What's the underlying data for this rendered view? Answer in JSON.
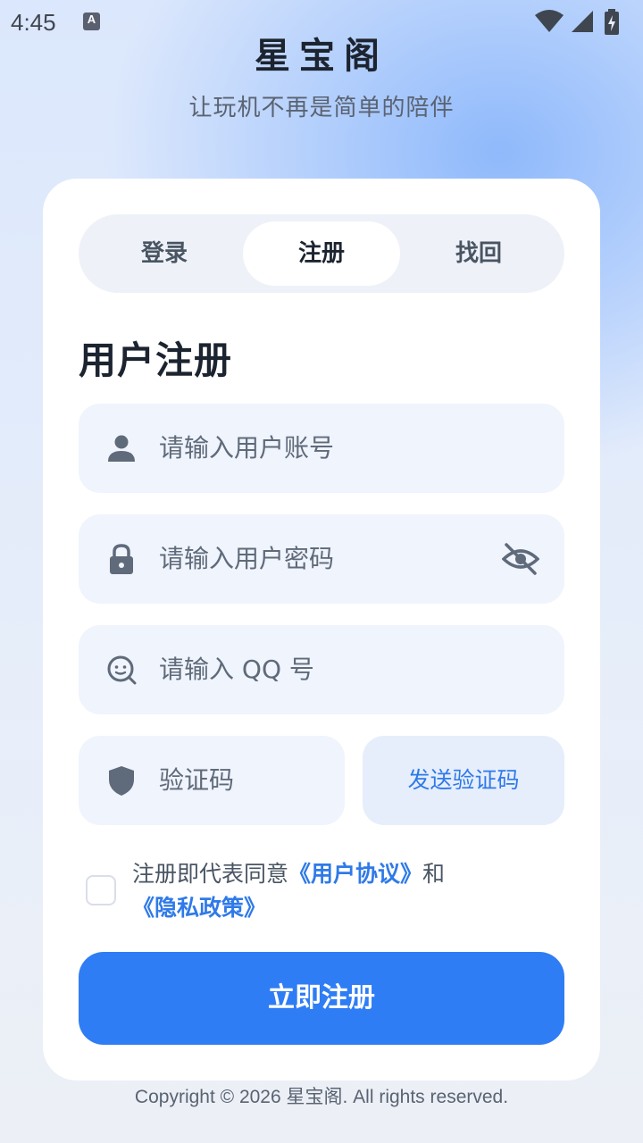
{
  "status_bar": {
    "time": "4:45",
    "notification_glyph": "A",
    "icons": [
      "notification-icon",
      "wifi-icon",
      "signal-icon",
      "battery-charging-icon"
    ]
  },
  "header": {
    "brand": "星宝阁",
    "slogan": "让玩机不再是简单的陪伴"
  },
  "tabs": [
    {
      "label": "登录",
      "active": false
    },
    {
      "label": "注册",
      "active": true
    },
    {
      "label": "找回",
      "active": false
    }
  ],
  "form": {
    "title": "用户注册",
    "account_placeholder": "请输入用户账号",
    "password_placeholder": "请输入用户密码",
    "qq_placeholder": "请输入 QQ 号",
    "code_placeholder": "验证码",
    "send_code_label": "发送验证码",
    "agreement": {
      "checked": false,
      "prefix": "注册即代表同意",
      "user_agreement": "《用户协议》",
      "conjunction": "和",
      "privacy_policy": "《隐私政策》"
    },
    "submit_label": "立即注册"
  },
  "footer": {
    "copyright": "Copyright © 2026 星宝阁. All rights reserved."
  },
  "colors": {
    "accent": "#2f7df4",
    "link": "#2f7ae8",
    "field_bg": "#f0f4fc",
    "card_bg": "#ffffff",
    "icon_gray": "#5f6a7a"
  }
}
